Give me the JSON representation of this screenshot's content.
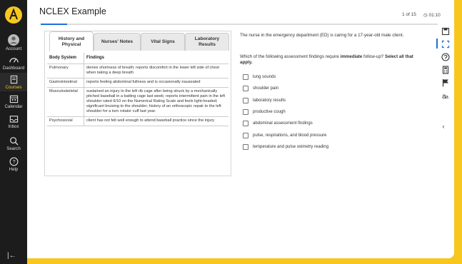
{
  "app": {
    "title": "NCLEX Example",
    "counter": "1 of 15",
    "timer": "01:10",
    "progress_fraction": 0.067
  },
  "sidebar": {
    "items": [
      {
        "label": "Account",
        "icon": "account-icon"
      },
      {
        "label": "Dashboard",
        "icon": "dashboard-icon"
      },
      {
        "label": "Courses",
        "icon": "courses-icon"
      },
      {
        "label": "Calendar",
        "icon": "calendar-icon"
      },
      {
        "label": "Inbox",
        "icon": "inbox-icon"
      },
      {
        "label": "Search",
        "icon": "search-icon"
      },
      {
        "label": "Help",
        "icon": "help-icon"
      }
    ],
    "active": "Courses",
    "collapse_glyph": "|←"
  },
  "tabs": [
    {
      "label": "History and Physical",
      "active": true
    },
    {
      "label": "Nurses' Notes",
      "active": false
    },
    {
      "label": "Vital Signs",
      "active": false
    },
    {
      "label": "Laboratory Results",
      "active": false
    }
  ],
  "table": {
    "headers": [
      "Body System",
      "Findings"
    ],
    "rows": [
      {
        "system": "Pulmonary",
        "findings": "denies shortness of breath; reports discomfort in the lower left side of chest when taking a deep breath"
      },
      {
        "system": "Gastrointestinal",
        "findings": "reports feeling abdominal fullness and is occasionally nauseated"
      },
      {
        "system": "Musculoskeletal",
        "findings": "sustained an injury to the left rib cage after being struck by a mechanically pitched baseball in a batting cage last week; reports intermittent pain in the left shoulder rated 6/10 on the Numerical Rating Scale and feels light-headed; significant bruising to the shoulder; history of an orthoscopic repair to the left shoulder for a torn rotator cuff last year."
      },
      {
        "system": "Psychosocial",
        "findings": "client has not felt well enough to attend baseball practice since the injury"
      }
    ]
  },
  "question": {
    "stem": "The nurse in the emergency department (ED) is caring for a 17-year-old male client.",
    "prompt_pre": "Which of the following assessment findings require ",
    "prompt_bold": "immediate",
    "prompt_post": " follow-up?  ",
    "instruction": "Select all that apply.",
    "options": [
      "lung sounds",
      "shoulder pain",
      "laboratory results",
      "productive cough",
      "abdominal assessment findings",
      "pulse, respirations, and blood pressure",
      "temperature and pulse oximetry reading"
    ]
  },
  "toolbar": {
    "tools": [
      "save-icon",
      "fullscreen-icon",
      "audio-icon",
      "calculator-icon",
      "flag-icon",
      "text-size-icon"
    ],
    "expand_glyph": "‹"
  },
  "colors": {
    "accent": "#1e6fd9",
    "frame": "#f7c71e",
    "sidebar": "#1c1c1c"
  }
}
